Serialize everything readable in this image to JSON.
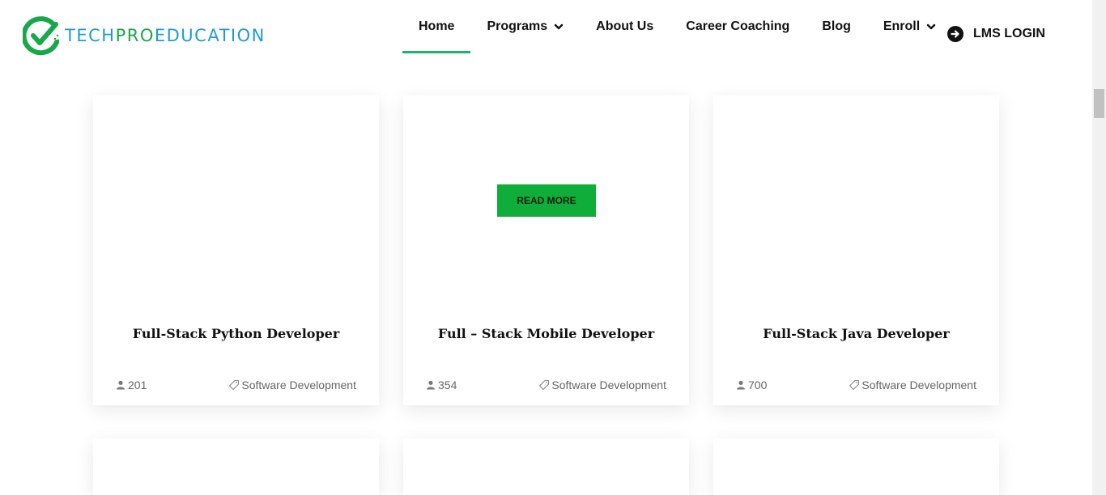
{
  "header": {
    "logo": {
      "text_part1": "TECH",
      "text_part2": "PRO",
      "text_part3": "EDUCATION"
    },
    "nav": [
      {
        "label": "Home",
        "active": true,
        "has_dropdown": false
      },
      {
        "label": "Programs",
        "active": false,
        "has_dropdown": true
      },
      {
        "label": "About Us",
        "active": false,
        "has_dropdown": false
      },
      {
        "label": "Career Coaching",
        "active": false,
        "has_dropdown": false
      },
      {
        "label": "Blog",
        "active": false,
        "has_dropdown": false
      },
      {
        "label": "Enroll",
        "active": false,
        "has_dropdown": true
      }
    ],
    "lms_login": "LMS LOGIN"
  },
  "cards": [
    {
      "title": "Full-Stack Python Developer",
      "students": "201",
      "category": "Software Development"
    },
    {
      "title": "Full – Stack Mobile Developer",
      "students": "354",
      "category": "Software Development",
      "button": "READ MORE"
    },
    {
      "title": "Full-Stack Java Developer",
      "students": "700",
      "category": "Software Development"
    }
  ],
  "colors": {
    "accent": "#1cb46a",
    "button": "#0fae3a",
    "logo_blue": "#1e9bd7",
    "logo_green": "#16a84a"
  },
  "icons": {
    "students": "user-icon",
    "category": "tag-icon",
    "login": "arrow-right-circle-icon",
    "dropdown": "chevron-down-icon"
  }
}
